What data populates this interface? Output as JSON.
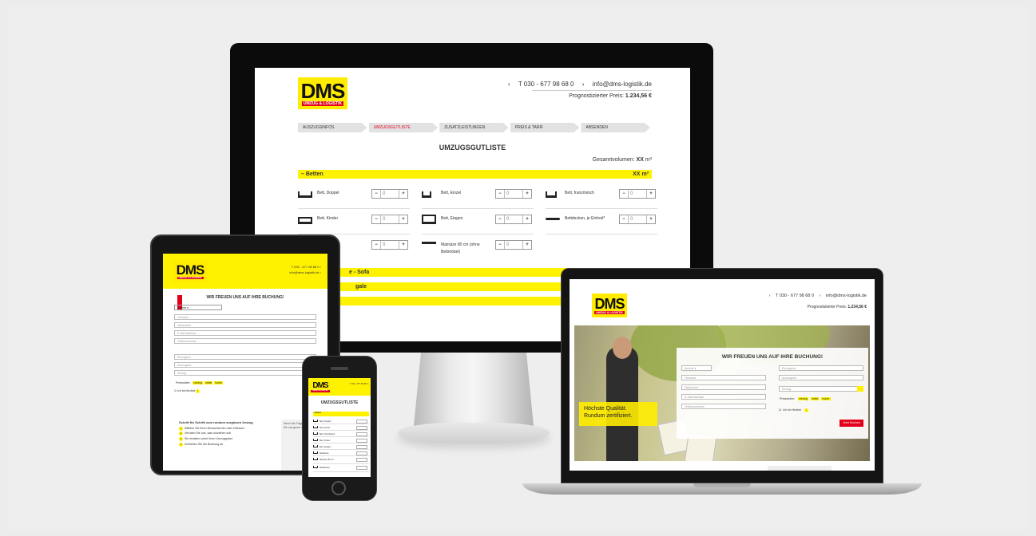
{
  "brand": {
    "logo_text": "DMS",
    "logo_sub": "UMZUG & LOGISTIK",
    "yellow": "#fff200",
    "red": "#e2001a"
  },
  "monitor": {
    "phone": "T 030 - 677 98 68 0",
    "email": "info@dms-logistik.de",
    "price_label": "Prognostizierter Preis:",
    "price_value": "1.234,56 €",
    "steps": [
      "AUSZUGSINFOS",
      "UMZUGSGUTLISTE",
      "ZUSATZLEISTUNGEN",
      "PREIS & TARIF",
      "ABSENDEN"
    ],
    "title": "UMZUGSGUTLISTE",
    "total_label": "Gesamtvolumen:",
    "total_value": "XX",
    "total_unit": "m³",
    "section_betten": "–  Betten",
    "section_betten_vol": "XX",
    "section_sofa": "e - Sofa",
    "section_regale": "gale",
    "items": [
      {
        "label": "Bett, Doppel",
        "value": "0"
      },
      {
        "label": "Bett, Einzel",
        "value": "0"
      },
      {
        "label": "Bett, französisch",
        "value": "0"
      },
      {
        "label": "Bett, Kinder",
        "value": "0"
      },
      {
        "label": "Bett, Etagen",
        "value": "0"
      },
      {
        "label": "Bettdecken, je Einheit*",
        "value": "0"
      },
      {
        "label": "",
        "value": "0"
      },
      {
        "label": "Matratze 80 cm (ohne Bettmöbel)",
        "value": "0"
      }
    ],
    "minus": "−",
    "plus": "+"
  },
  "tablet": {
    "phone": "T 030 - 677 98 68 0 ‹",
    "email": "info@dms-logistik.de ‹",
    "title": "WIR FREUEN UNS AUF IHRE BUCHUNG!",
    "salutation": "Anrede",
    "fields": [
      "Vorname",
      "Nachname",
      "E-Mail Adresse",
      "Telefonnummer",
      "Einzugsort",
      "Auszugsort",
      "Kmzug"
    ],
    "pres_label": "Preisstufen:",
    "pres_levels": [
      "niedrig",
      "mittel",
      "hoher"
    ],
    "flexible": "Ich bin flexibel",
    "steps_title": "Schritt für Schritt zum rundum sorglosen Umzug",
    "steps": [
      "Wählen Sie Ihren Wunschtermin oder Zeitraum",
      "Verraten Sie uns, was umziehen soll",
      "Sie erhalten sofort Ihren Umzugsplan!",
      "Schließen Sie die Buchung ab"
    ],
    "side_text": "Wenn Sie Fragen haben, können Sie uns gerne direkt kontaktieren."
  },
  "phone": {
    "contact": "T 030 - 677 98 68 0 ‹",
    "title": "UMZUGSGUTLISTE",
    "section": "Betten",
    "rows": [
      "Bett, Doppel",
      "Bett, Einzel",
      "Bett, französisch",
      "Bett, Kinder",
      "Bett, Etagen",
      "Bettdecke",
      "Matratze 80 cm",
      "Bettdecken"
    ]
  },
  "laptop": {
    "phone": "T 030 - 677 98 68 0",
    "email": "info@dms-logistik.de",
    "price_label": "Prognostizierter Preis:",
    "price_value": "1.234,56 €",
    "hero_line1": "Höchste Qualität.",
    "hero_line2": "Rundum zertifiziert.",
    "form_title": "WIR FREUEN UNS AUF IHRE BUCHUNG!",
    "salutation": "Anrede",
    "left_fields": [
      "Vorname",
      "Nachname",
      "E-Mail Adresse",
      "Telefonnummer"
    ],
    "right_fields": [
      "Einzugsort",
      "Auszugsort",
      "Kmzug"
    ],
    "pres_label": "Preisstufen:",
    "pres_levels": [
      "niedrig",
      "mittel",
      "hoher"
    ],
    "flexible": "Ich bin flexibel",
    "submit": "Jetzt Buchen"
  }
}
